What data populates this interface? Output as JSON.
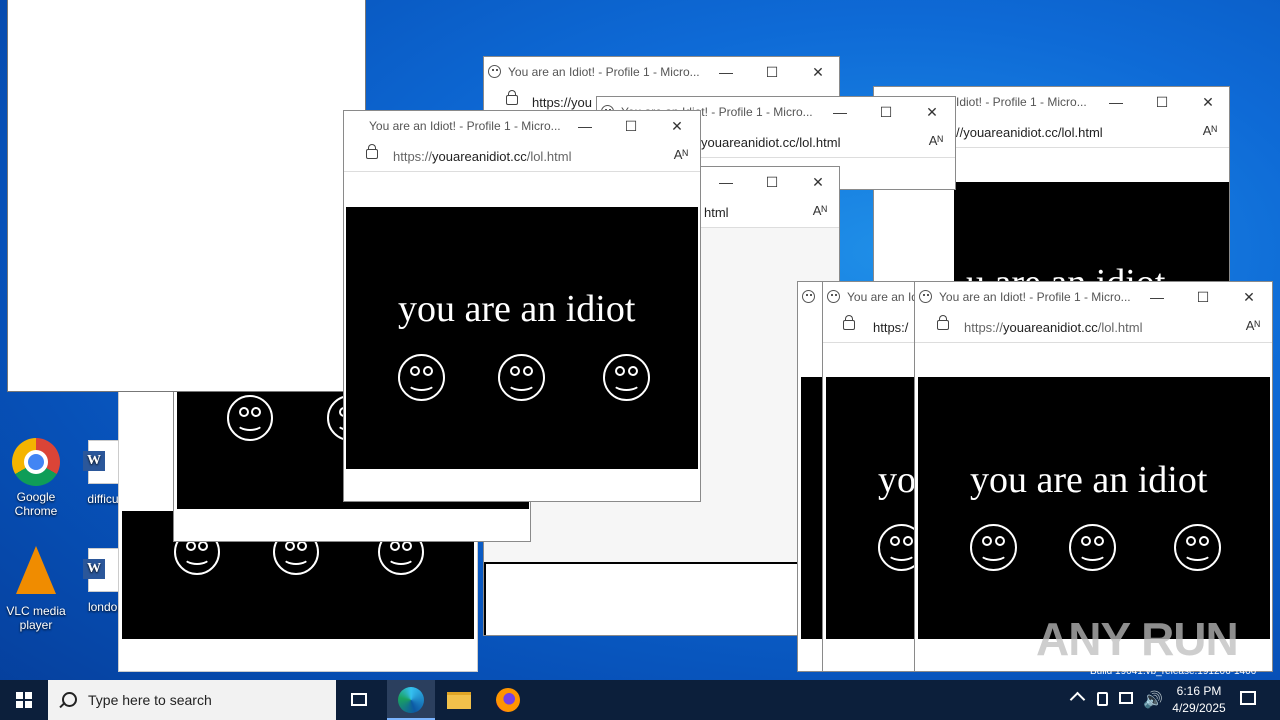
{
  "window_title": "You are an Idiot! - Profile 1 - Micro...",
  "url_host": "youareanidiot.cc",
  "url_scheme": "https://",
  "url_path": "/lol.html",
  "partial": {
    "url_https_you": "https://you",
    "url_mid": "youareanidiot.cc/lol.html",
    "url_right": "//youareanidiot.cc/lol.html",
    "url_tml": "html",
    "url_https_slash": "https:/",
    "title_short": "You are an Id",
    "title_right": "Idiot! - Profile 1 - Micro...",
    "idiot_partial": "yo",
    "idiot_top": "u are an idiot"
  },
  "idiot_text": "you are an idiot",
  "controls": {
    "minimize": "—",
    "maximize": "☐",
    "close": "✕",
    "read_aloud": "Aᴺ"
  },
  "desktop_icons": [
    {
      "label_line1": "Google",
      "label_line2": "Chrome",
      "icon": "chrome-icon"
    },
    {
      "label_line1": "difficult",
      "label_line2": "",
      "icon": "word-doc-icon"
    },
    {
      "label_line1": "VLC media",
      "label_line2": "player",
      "icon": "vlc-icon"
    },
    {
      "label_line1": "london",
      "label_line2": "",
      "icon": "word-doc-icon"
    }
  ],
  "taskbar": {
    "search_placeholder": "Type here to search",
    "time": "6:16 PM",
    "date": "4/29/2025"
  },
  "watermark": "ANY RUN",
  "build_text": "Build 19041.vb_release.191206-1406"
}
